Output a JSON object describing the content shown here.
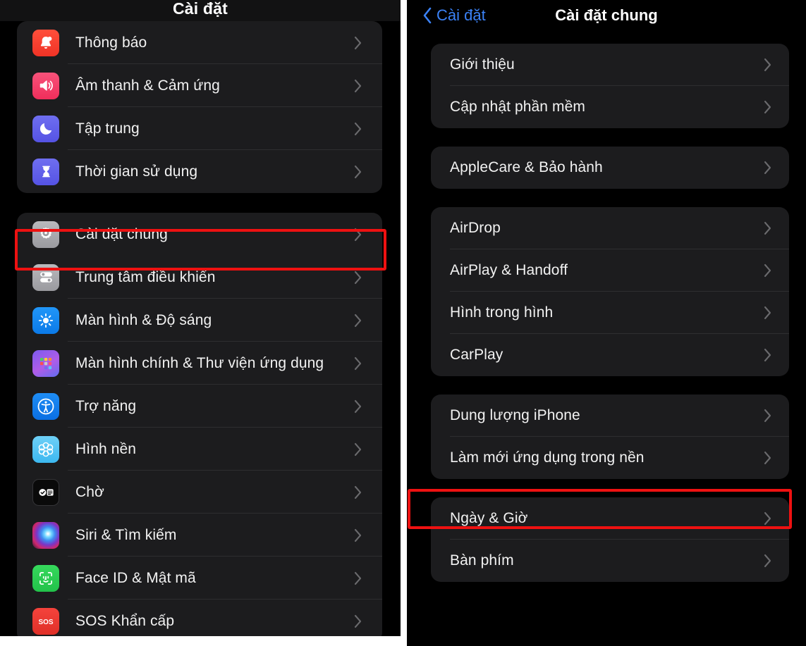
{
  "left_screen": {
    "nav": {
      "title": "Cài đặt"
    },
    "groups": [
      {
        "rows": [
          {
            "label": "Thông báo",
            "icon": "notifications-icon"
          },
          {
            "label": "Âm thanh & Cảm ứng",
            "icon": "sound-haptics-icon"
          },
          {
            "label": "Tập trung",
            "icon": "focus-icon"
          },
          {
            "label": "Thời gian sử dụng",
            "icon": "screen-time-icon"
          }
        ]
      },
      {
        "rows": [
          {
            "label": "Cài đặt chung",
            "icon": "general-gear-icon"
          },
          {
            "label": "Trung tâm điều khiển",
            "icon": "control-center-icon"
          },
          {
            "label": "Màn hình & Độ sáng",
            "icon": "display-brightness-icon"
          },
          {
            "label": "Màn hình chính & Thư viện ứng dụng",
            "icon": "home-screen-icon"
          },
          {
            "label": "Trợ năng",
            "icon": "accessibility-icon"
          },
          {
            "label": "Hình nền",
            "icon": "wallpaper-icon"
          },
          {
            "label": "Chờ",
            "icon": "standby-icon"
          },
          {
            "label": "Siri & Tìm kiếm",
            "icon": "siri-icon"
          },
          {
            "label": "Face ID & Mật mã",
            "icon": "face-id-icon"
          },
          {
            "label": "SOS Khẩn cấp",
            "icon": "emergency-sos-icon"
          }
        ]
      }
    ],
    "highlighted_row": "Cài đặt chung"
  },
  "right_screen": {
    "nav": {
      "back_label": "Cài đặt",
      "back_icon": "chevron-left-icon",
      "title": "Cài đặt chung"
    },
    "groups": [
      {
        "rows": [
          {
            "label": "Giới thiệu"
          },
          {
            "label": "Cập nhật phần mềm"
          }
        ]
      },
      {
        "rows": [
          {
            "label": "AppleCare & Bảo hành"
          }
        ]
      },
      {
        "rows": [
          {
            "label": "AirDrop"
          },
          {
            "label": "AirPlay & Handoff"
          },
          {
            "label": "Hình trong hình"
          },
          {
            "label": "CarPlay"
          }
        ]
      },
      {
        "rows": [
          {
            "label": "Dung lượng iPhone"
          },
          {
            "label": "Làm mới ứng dụng trong nền"
          }
        ]
      },
      {
        "rows": [
          {
            "label": "Ngày & Giờ"
          },
          {
            "label": "Bàn phím"
          }
        ]
      }
    ],
    "highlighted_row": "Làm mới ứng dụng trong nền"
  },
  "colors": {
    "background": "#000000",
    "card": "#1c1c1e",
    "accent_blue": "#3b82f6",
    "highlight_red": "#ee1111",
    "chevron": "#6a6a6d",
    "label_text": "#f2f2f2"
  }
}
